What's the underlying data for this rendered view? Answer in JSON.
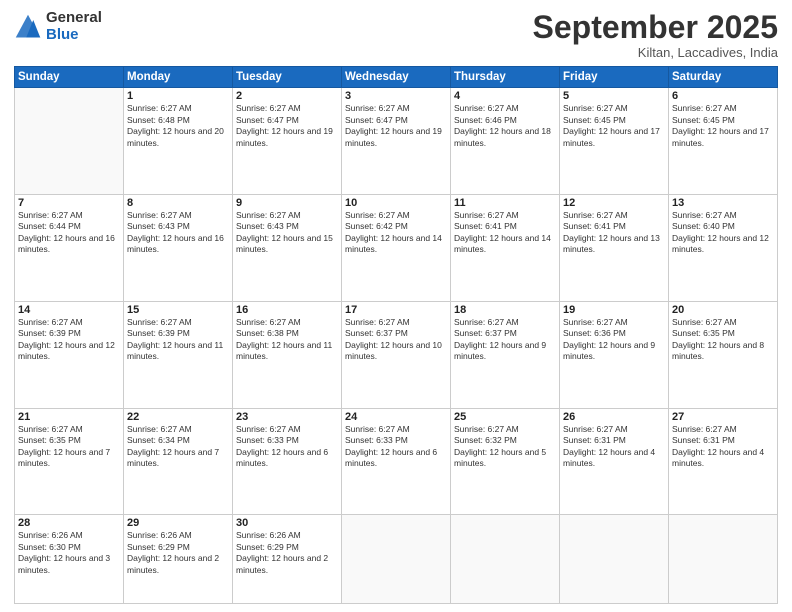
{
  "logo": {
    "general": "General",
    "blue": "Blue"
  },
  "header": {
    "month": "September 2025",
    "location": "Kiltan, Laccadives, India"
  },
  "weekdays": [
    "Sunday",
    "Monday",
    "Tuesday",
    "Wednesday",
    "Thursday",
    "Friday",
    "Saturday"
  ],
  "weeks": [
    [
      {
        "day": "",
        "sunrise": "",
        "sunset": "",
        "daylight": ""
      },
      {
        "day": "1",
        "sunrise": "Sunrise: 6:27 AM",
        "sunset": "Sunset: 6:48 PM",
        "daylight": "Daylight: 12 hours and 20 minutes."
      },
      {
        "day": "2",
        "sunrise": "Sunrise: 6:27 AM",
        "sunset": "Sunset: 6:47 PM",
        "daylight": "Daylight: 12 hours and 19 minutes."
      },
      {
        "day": "3",
        "sunrise": "Sunrise: 6:27 AM",
        "sunset": "Sunset: 6:47 PM",
        "daylight": "Daylight: 12 hours and 19 minutes."
      },
      {
        "day": "4",
        "sunrise": "Sunrise: 6:27 AM",
        "sunset": "Sunset: 6:46 PM",
        "daylight": "Daylight: 12 hours and 18 minutes."
      },
      {
        "day": "5",
        "sunrise": "Sunrise: 6:27 AM",
        "sunset": "Sunset: 6:45 PM",
        "daylight": "Daylight: 12 hours and 17 minutes."
      },
      {
        "day": "6",
        "sunrise": "Sunrise: 6:27 AM",
        "sunset": "Sunset: 6:45 PM",
        "daylight": "Daylight: 12 hours and 17 minutes."
      }
    ],
    [
      {
        "day": "7",
        "sunrise": "Sunrise: 6:27 AM",
        "sunset": "Sunset: 6:44 PM",
        "daylight": "Daylight: 12 hours and 16 minutes."
      },
      {
        "day": "8",
        "sunrise": "Sunrise: 6:27 AM",
        "sunset": "Sunset: 6:43 PM",
        "daylight": "Daylight: 12 hours and 16 minutes."
      },
      {
        "day": "9",
        "sunrise": "Sunrise: 6:27 AM",
        "sunset": "Sunset: 6:43 PM",
        "daylight": "Daylight: 12 hours and 15 minutes."
      },
      {
        "day": "10",
        "sunrise": "Sunrise: 6:27 AM",
        "sunset": "Sunset: 6:42 PM",
        "daylight": "Daylight: 12 hours and 14 minutes."
      },
      {
        "day": "11",
        "sunrise": "Sunrise: 6:27 AM",
        "sunset": "Sunset: 6:41 PM",
        "daylight": "Daylight: 12 hours and 14 minutes."
      },
      {
        "day": "12",
        "sunrise": "Sunrise: 6:27 AM",
        "sunset": "Sunset: 6:41 PM",
        "daylight": "Daylight: 12 hours and 13 minutes."
      },
      {
        "day": "13",
        "sunrise": "Sunrise: 6:27 AM",
        "sunset": "Sunset: 6:40 PM",
        "daylight": "Daylight: 12 hours and 12 minutes."
      }
    ],
    [
      {
        "day": "14",
        "sunrise": "Sunrise: 6:27 AM",
        "sunset": "Sunset: 6:39 PM",
        "daylight": "Daylight: 12 hours and 12 minutes."
      },
      {
        "day": "15",
        "sunrise": "Sunrise: 6:27 AM",
        "sunset": "Sunset: 6:39 PM",
        "daylight": "Daylight: 12 hours and 11 minutes."
      },
      {
        "day": "16",
        "sunrise": "Sunrise: 6:27 AM",
        "sunset": "Sunset: 6:38 PM",
        "daylight": "Daylight: 12 hours and 11 minutes."
      },
      {
        "day": "17",
        "sunrise": "Sunrise: 6:27 AM",
        "sunset": "Sunset: 6:37 PM",
        "daylight": "Daylight: 12 hours and 10 minutes."
      },
      {
        "day": "18",
        "sunrise": "Sunrise: 6:27 AM",
        "sunset": "Sunset: 6:37 PM",
        "daylight": "Daylight: 12 hours and 9 minutes."
      },
      {
        "day": "19",
        "sunrise": "Sunrise: 6:27 AM",
        "sunset": "Sunset: 6:36 PM",
        "daylight": "Daylight: 12 hours and 9 minutes."
      },
      {
        "day": "20",
        "sunrise": "Sunrise: 6:27 AM",
        "sunset": "Sunset: 6:35 PM",
        "daylight": "Daylight: 12 hours and 8 minutes."
      }
    ],
    [
      {
        "day": "21",
        "sunrise": "Sunrise: 6:27 AM",
        "sunset": "Sunset: 6:35 PM",
        "daylight": "Daylight: 12 hours and 7 minutes."
      },
      {
        "day": "22",
        "sunrise": "Sunrise: 6:27 AM",
        "sunset": "Sunset: 6:34 PM",
        "daylight": "Daylight: 12 hours and 7 minutes."
      },
      {
        "day": "23",
        "sunrise": "Sunrise: 6:27 AM",
        "sunset": "Sunset: 6:33 PM",
        "daylight": "Daylight: 12 hours and 6 minutes."
      },
      {
        "day": "24",
        "sunrise": "Sunrise: 6:27 AM",
        "sunset": "Sunset: 6:33 PM",
        "daylight": "Daylight: 12 hours and 6 minutes."
      },
      {
        "day": "25",
        "sunrise": "Sunrise: 6:27 AM",
        "sunset": "Sunset: 6:32 PM",
        "daylight": "Daylight: 12 hours and 5 minutes."
      },
      {
        "day": "26",
        "sunrise": "Sunrise: 6:27 AM",
        "sunset": "Sunset: 6:31 PM",
        "daylight": "Daylight: 12 hours and 4 minutes."
      },
      {
        "day": "27",
        "sunrise": "Sunrise: 6:27 AM",
        "sunset": "Sunset: 6:31 PM",
        "daylight": "Daylight: 12 hours and 4 minutes."
      }
    ],
    [
      {
        "day": "28",
        "sunrise": "Sunrise: 6:26 AM",
        "sunset": "Sunset: 6:30 PM",
        "daylight": "Daylight: 12 hours and 3 minutes."
      },
      {
        "day": "29",
        "sunrise": "Sunrise: 6:26 AM",
        "sunset": "Sunset: 6:29 PM",
        "daylight": "Daylight: 12 hours and 2 minutes."
      },
      {
        "day": "30",
        "sunrise": "Sunrise: 6:26 AM",
        "sunset": "Sunset: 6:29 PM",
        "daylight": "Daylight: 12 hours and 2 minutes."
      },
      {
        "day": "",
        "sunrise": "",
        "sunset": "",
        "daylight": ""
      },
      {
        "day": "",
        "sunrise": "",
        "sunset": "",
        "daylight": ""
      },
      {
        "day": "",
        "sunrise": "",
        "sunset": "",
        "daylight": ""
      },
      {
        "day": "",
        "sunrise": "",
        "sunset": "",
        "daylight": ""
      }
    ]
  ]
}
